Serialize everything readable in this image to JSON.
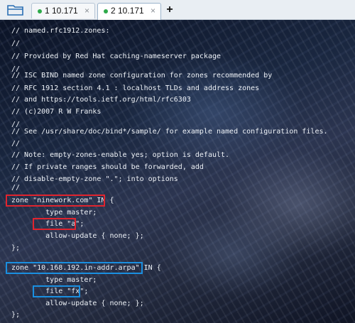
{
  "tabs": [
    {
      "label": "1 10.171",
      "close": "×",
      "status_color": "#2eaa4a"
    },
    {
      "label": "2 10.171",
      "close": "×",
      "status_color": "#2eaa4a"
    }
  ],
  "new_tab_label": "+",
  "terminal": {
    "lines": [
      "// named.rfc1912.zones:",
      "//",
      "// Provided by Red Hat caching-nameserver package",
      "//",
      "// ISC BIND named zone configuration for zones recommended by",
      "// RFC 1912 section 4.1 : localhost TLDs and address zones",
      "// and https://tools.ietf.org/html/rfc6303",
      "// (c)2007 R W Franks",
      "//",
      "// See /usr/share/doc/bind*/sample/ for example named configuration files.",
      "//",
      "// Note: empty-zones-enable yes; option is default.",
      "// If private ranges should be forwarded, add",
      "// disable-empty-zone \".\"; into options",
      "//",
      "zone \"ninework.com\" IN {",
      "        type master;",
      "        file \"a\";",
      "        allow-update { none; };",
      "};",
      "",
      "zone \"10.168.192.in-addr.arpa\" IN {",
      "        type master;",
      "        file \"fx\";",
      "        allow-update { none; };",
      "};"
    ]
  },
  "highlight_colors": {
    "red": "#e0242e",
    "blue": "#1a8fe0"
  }
}
